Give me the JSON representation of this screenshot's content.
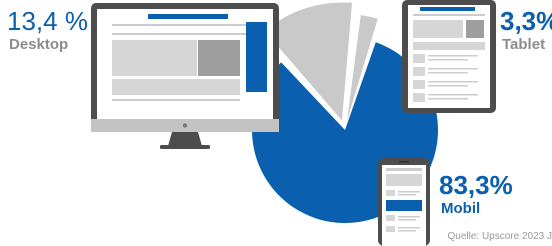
{
  "chart_data": {
    "type": "pie",
    "categories": [
      "Desktop",
      "Tablet",
      "Mobil"
    ],
    "values": [
      13.4,
      3.3,
      83.3
    ],
    "value_labels": [
      "13,4 %",
      "3,3%",
      "83,3%"
    ],
    "source": "Quelle: Upscore 2023 J"
  },
  "colors": {
    "mobile": "#0a5fae",
    "desktop": "#c9c9c9",
    "tablet": "#c9c9c9",
    "device": "#4d4d4d",
    "label_blue": "#0a5fae",
    "label_gray": "#8c8c8c"
  },
  "icons": [
    "desktop-monitor-icon",
    "tablet-icon",
    "smartphone-icon"
  ]
}
